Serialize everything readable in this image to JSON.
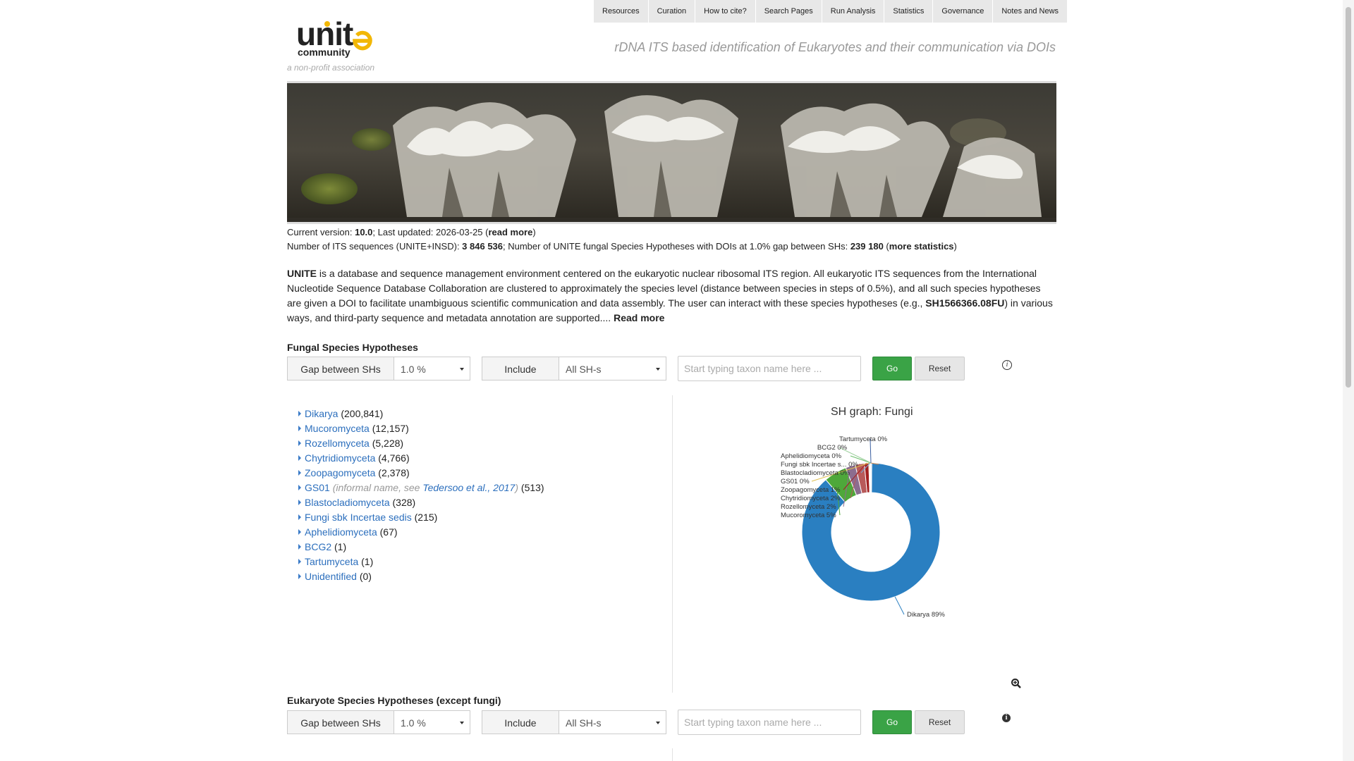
{
  "nav": [
    "Resources",
    "Curation",
    "How to cite?",
    "Search Pages",
    "Run Analysis",
    "Statistics",
    "Governance",
    "Notes and News"
  ],
  "logo": {
    "word": "unite",
    "sub": "community"
  },
  "tagline_left": "a non-profit association",
  "tagline_right": "rDNA ITS based identification of Eukaryotes and their communication via DOIs",
  "version_line": {
    "prefix": "Current version: ",
    "version": "10.0",
    "middle": "; Last updated: 2026-03-25 (",
    "link": "read more",
    "suffix": ")"
  },
  "count_line": {
    "prefix": "Number of ITS sequences (UNITE+INSD): ",
    "seq_count": "3 846 536",
    "middle": "; Number of UNITE fungal Species Hypotheses with DOIs at 1.0% gap between SHs: ",
    "sh_count": "239 180",
    "open": " (",
    "link": "more statistics",
    "close": ")"
  },
  "description": {
    "lead": "UNITE",
    "body1": " is a database and sequence management environment centered on the eukaryotic nuclear ribosomal ITS region. All eukaryotic ITS sequences from the International Nucleotide Sequence Database Collaboration are clustered to approximately the species level (distance between species in steps of 0.5%), and all such species hypotheses are given a DOI to facilitate unambiguous scientific communication and data assembly. The user can interact with these species hypotheses (e.g., ",
    "example": "SH1566366.08FU",
    "body2": ") in various ways, and third-party sequence and metadata annotation are supported.... ",
    "read_more": "Read more"
  },
  "fungal": {
    "title": "Fungal Species Hypotheses",
    "gap_label": "Gap between SHs",
    "gap_value": "1.0 %",
    "include_label": "Include",
    "include_value": "All SH-s",
    "search_placeholder": "Start typing taxon name here ...",
    "go": "Go",
    "reset": "Reset"
  },
  "taxa": [
    {
      "name": "Dikarya",
      "count": "(200,841)"
    },
    {
      "name": "Mucoromyceta",
      "count": "(12,157)"
    },
    {
      "name": "Rozellomyceta",
      "count": "(5,228)"
    },
    {
      "name": "Chytridiomyceta",
      "count": "(4,766)"
    },
    {
      "name": "Zoopagomyceta",
      "count": "(2,378)"
    },
    {
      "name": "GS01",
      "note_pre": "(informal name, see ",
      "note_link": "Tedersoo et al., 2017",
      "note_post": ")",
      "count": "(513)"
    },
    {
      "name": "Blastocladiomyceta",
      "count": "(328)"
    },
    {
      "name": "Fungi sbk Incertae sedis",
      "count": "(215)"
    },
    {
      "name": "Aphelidiomyceta",
      "count": "(67)"
    },
    {
      "name": "BCG2",
      "count": "(1)"
    },
    {
      "name": "Tartumyceta",
      "count": "(1)"
    },
    {
      "name": "Unidentified",
      "count": "(0)"
    }
  ],
  "chart_title": "SH graph: Fungi",
  "chart_data": {
    "type": "pie",
    "title": "SH graph: Fungi",
    "donut": true,
    "slices": [
      {
        "label": "Dikarya",
        "pct_label": "89%",
        "value": 200841,
        "color": "#2a7fc1"
      },
      {
        "label": "Mucoromyceta",
        "pct_label": "5%",
        "value": 12157,
        "color": "#4ea83a"
      },
      {
        "label": "Rozellomyceta",
        "pct_label": "2%",
        "value": 5228,
        "color": "#8c6d8f"
      },
      {
        "label": "Chytridiomyceta",
        "pct_label": "2%",
        "value": 4766,
        "color": "#b85a5a"
      },
      {
        "label": "Zoopagomyceta",
        "pct_label": "1%",
        "value": 2378,
        "color": "#a32020"
      },
      {
        "label": "GS01",
        "pct_label": "0%",
        "value": 513,
        "color": "#e0c050"
      },
      {
        "label": "Blastocladiomyceta",
        "pct_label": "0%",
        "value": 328,
        "color": "#7aa7d4"
      },
      {
        "label": "Fungi sbk Incertae s...",
        "pct_label": "0%",
        "value": 215,
        "color": "#d98a4b"
      },
      {
        "label": "Aphelidiomyceta",
        "pct_label": "0%",
        "value": 67,
        "color": "#6cbf6c"
      },
      {
        "label": "BCG2",
        "pct_label": "0%",
        "value": 1,
        "color": "#9ccf9c"
      },
      {
        "label": "Tartumyceta",
        "pct_label": "0%",
        "value": 1,
        "color": "#3b5fa0"
      }
    ]
  },
  "eukaryote": {
    "title": "Eukaryote Species Hypotheses (except fungi)",
    "gap_label": "Gap between SHs",
    "gap_value": "1.0 %",
    "include_label": "Include",
    "include_value": "All SH-s",
    "search_placeholder": "Start typing taxon name here ...",
    "go": "Go",
    "reset": "Reset"
  },
  "colors": {
    "link": "#2c6fbd",
    "go_button": "#3aa346",
    "accent_logo": "#f2b705"
  }
}
